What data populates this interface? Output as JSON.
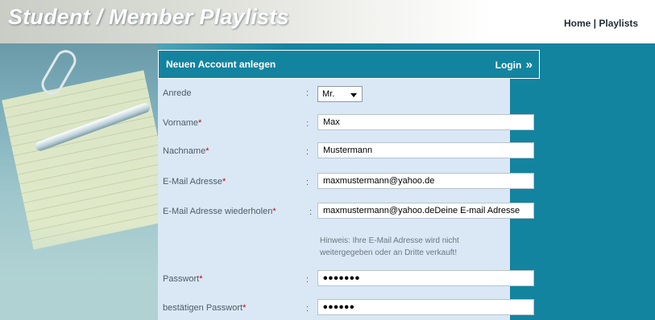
{
  "header": {
    "site_title": "Student / Member Playlists",
    "nav_home": "Home",
    "nav_separator": " | ",
    "nav_playlists": "Playlists"
  },
  "form": {
    "title": "Neuen Account anlegen",
    "login_label": "Login",
    "login_arrow": "»",
    "colon": ":",
    "required_mark": "*",
    "fields": [
      {
        "label": "Anrede",
        "value": "Mr.",
        "required": false
      },
      {
        "label": "Vorname",
        "value": "Max",
        "required": true
      },
      {
        "label": "Nachname",
        "value": "Mustermann",
        "required": true
      },
      {
        "label": "E-Mail Adresse",
        "value": "maxmustermann@yahoo.de",
        "required": true
      },
      {
        "label": "E-Mail Adresse wiederholen",
        "value": "maxmustermann@yahoo.deDeine E-mail Adresse",
        "required": true
      },
      {
        "label": "Passwort",
        "value": "•••••••",
        "required": true
      },
      {
        "label": "bestätigen Passwort",
        "value": "••••••",
        "required": true
      }
    ],
    "hint": "Hinweis: Ihre E-Mail Adresse wird nicht weitergegeben oder an Dritte verkauft!"
  },
  "colors": {
    "teal": "#13849f",
    "form_bg": "#dae8f5",
    "required": "#cc0000"
  }
}
